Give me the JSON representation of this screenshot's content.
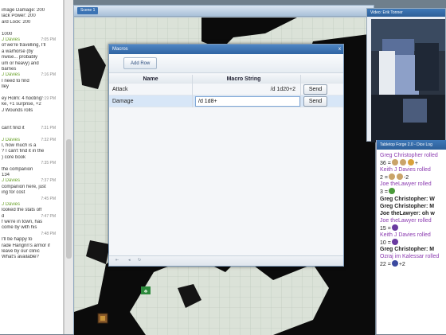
{
  "chat": {
    "lines": [
      {
        "text": "image Damage: 200",
        "kind": "text",
        "ts": ""
      },
      {
        "text": "lack Power: 200",
        "kind": "text",
        "ts": ""
      },
      {
        "text": "ard Lock: 200",
        "kind": "text",
        "ts": ""
      },
      {
        "text": "",
        "kind": "text",
        "ts": ""
      },
      {
        "text": "1000",
        "kind": "text",
        "ts": ""
      },
      {
        "text": "J Davies",
        "kind": "name",
        "ts": "7:05 PM"
      },
      {
        "text": "of we're travelling, I'll",
        "kind": "text",
        "ts": ""
      },
      {
        "text": "a warhorse (by",
        "kind": "text",
        "ts": ""
      },
      {
        "text": "nwise... probably",
        "kind": "text",
        "ts": ""
      },
      {
        "text": "um or heavy) and",
        "kind": "text",
        "ts": ""
      },
      {
        "text": "barnes",
        "kind": "text",
        "ts": ""
      },
      {
        "text": "J Davies",
        "kind": "name",
        "ts": "7:16 PM"
      },
      {
        "text": "I need to find",
        "kind": "text",
        "ts": ""
      },
      {
        "text": "lley",
        "kind": "text",
        "ts": ""
      },
      {
        "text": "",
        "kind": "text",
        "ts": ""
      },
      {
        "text": "ey Holm: 4 hooting",
        "kind": "text",
        "ts": "7:19 PM"
      },
      {
        "text": "ke, +1 surprise, +2",
        "kind": "text",
        "ts": ""
      },
      {
        "text": "J Wounds rolls",
        "kind": "text",
        "ts": ""
      },
      {
        "text": "",
        "kind": "text",
        "ts": ""
      },
      {
        "text": "",
        "kind": "text",
        "ts": ""
      },
      {
        "text": "can't find it",
        "kind": "text",
        "ts": "7:31 PM"
      },
      {
        "text": "",
        "kind": "text",
        "ts": ""
      },
      {
        "text": "J Davies",
        "kind": "name",
        "ts": "7:32 PM"
      },
      {
        "text": "I, how much is a",
        "kind": "text",
        "ts": ""
      },
      {
        "text": "? I can't find it in the",
        "kind": "text",
        "ts": ""
      },
      {
        "text": ") core book",
        "kind": "text",
        "ts": ""
      },
      {
        "text": "",
        "kind": "text",
        "ts": "7:35 PM"
      },
      {
        "text": "the companion",
        "kind": "text",
        "ts": ""
      },
      {
        "text": "134",
        "kind": "text",
        "ts": ""
      },
      {
        "text": "J Davies",
        "kind": "name",
        "ts": "7:37 PM"
      },
      {
        "text": "companion here, just",
        "kind": "text",
        "ts": ""
      },
      {
        "text": "ing for cost",
        "kind": "text",
        "ts": ""
      },
      {
        "text": "",
        "kind": "text",
        "ts": "7:45 PM"
      },
      {
        "text": "J Davies",
        "kind": "name",
        "ts": ""
      },
      {
        "text": "looked the stats off",
        "kind": "text",
        "ts": ""
      },
      {
        "text": "d",
        "kind": "text",
        "ts": "7:47 PM"
      },
      {
        "text": "f we're in town, has",
        "kind": "text",
        "ts": ""
      },
      {
        "text": "come by with his",
        "kind": "text",
        "ts": ""
      },
      {
        "text": "",
        "kind": "text",
        "ts": "7:48 PM"
      },
      {
        "text": "I'll be happy to",
        "kind": "text",
        "ts": ""
      },
      {
        "text": "rade Hangrin's armor if",
        "kind": "text",
        "ts": ""
      },
      {
        "text": "leave by our clinic",
        "kind": "text",
        "ts": ""
      },
      {
        "text": "What's available?",
        "kind": "text",
        "ts": ""
      }
    ]
  },
  "map_window": {
    "tab_label": "Scene 1"
  },
  "video": {
    "title": "Video: Erik Tonner"
  },
  "dice_log": {
    "title": "Tabletop Forge 2.0 - Dice Log",
    "lines": [
      {
        "text": "Greg Christopher rolled",
        "kind": "user"
      },
      {
        "text": "36 =",
        "kind": "result",
        "faces": [
          "#c9a46a",
          "#c9a46a",
          "#d9a23a"
        ],
        "suffix": "+"
      },
      {
        "text": "Keith J Davies rolled",
        "kind": "user"
      },
      {
        "text": "2 =",
        "kind": "result",
        "faces": [
          "#c9a46a",
          "#c9a46a"
        ],
        "suffix": "-2"
      },
      {
        "text": "Joe theLawyer rolled",
        "kind": "user"
      },
      {
        "text": "3 =",
        "kind": "result",
        "faces": [
          "#4a9a3a"
        ],
        "suffix": ""
      },
      {
        "text": "Greg Christopher: W",
        "kind": "bold"
      },
      {
        "text": "Greg Christopher: M",
        "kind": "bold"
      },
      {
        "text": "Joe theLawyer: oh w",
        "kind": "bold"
      },
      {
        "text": "Joe theLawyer rolled",
        "kind": "user"
      },
      {
        "text": "15 =",
        "kind": "result",
        "faces": [
          "#6a3aa0"
        ],
        "suffix": ""
      },
      {
        "text": "Keith J Davies rolled",
        "kind": "user"
      },
      {
        "text": "10 =",
        "kind": "result",
        "faces": [
          "#6a3aa0"
        ],
        "suffix": ""
      },
      {
        "text": "Greg Christopher: M",
        "kind": "bold"
      },
      {
        "text": "Ozraj im Kalessar rolled",
        "kind": "user"
      },
      {
        "text": "22 =",
        "kind": "result",
        "faces": [
          "#3b4aa0"
        ],
        "suffix": "+2"
      }
    ]
  },
  "macro_dialog": {
    "title": "Macros",
    "close_label": "x",
    "add_row_label": "Add Row",
    "columns": {
      "name": "Name",
      "macro": "Macro String"
    },
    "rows": [
      {
        "name": "Attack",
        "macro": "/d 1d20+2",
        "send_label": "Send",
        "editing": false
      },
      {
        "name": "Damage",
        "macro": "/d 1d8+",
        "send_label": "Send",
        "editing": true
      }
    ]
  },
  "colors": {
    "titlebar": "#2f64a2",
    "selected_row": "#d7e6f7",
    "chat_name": "#6aa22a",
    "dice_user": "#8b3bb0"
  }
}
